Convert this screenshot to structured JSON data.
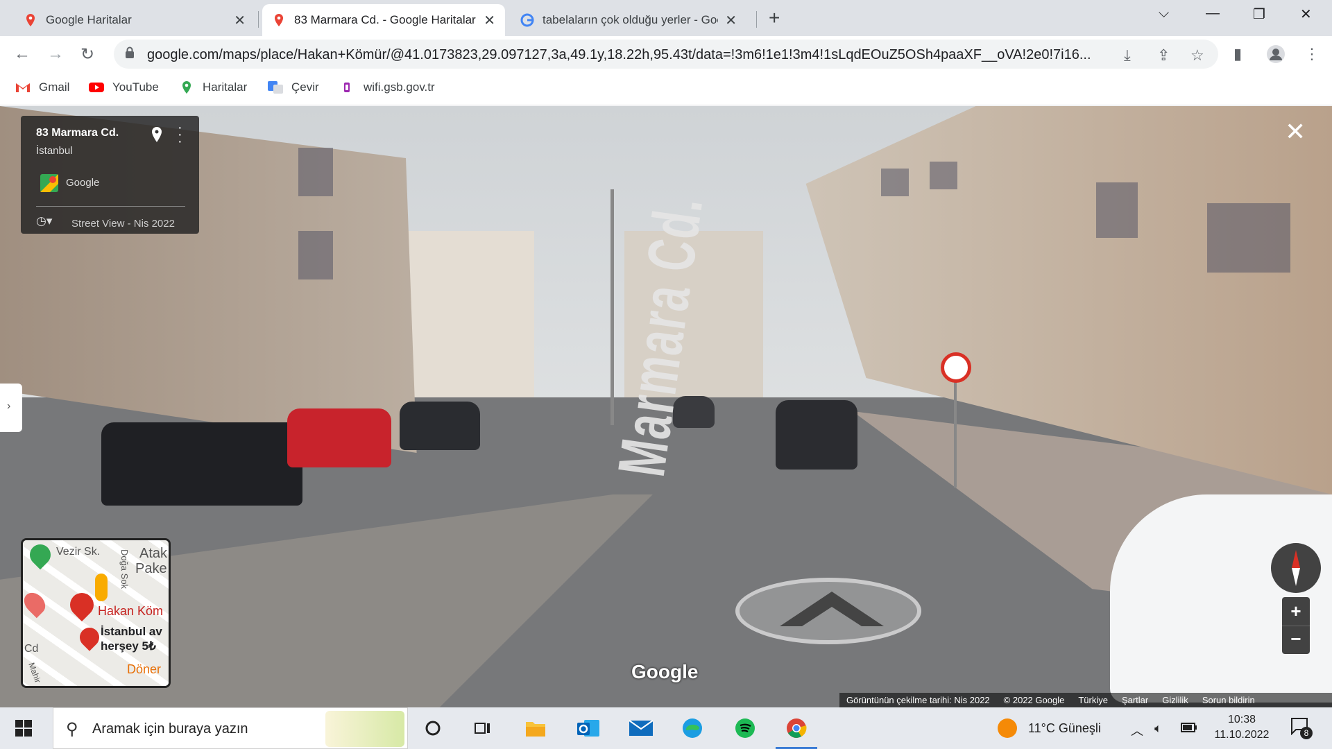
{
  "browser": {
    "tabs": [
      {
        "label": "Google Haritalar"
      },
      {
        "label": "83 Marmara Cd. - Google Haritalar"
      },
      {
        "label": "tabelaların çok olduğu yerler - Google"
      }
    ],
    "url": "google.com/maps/place/Hakan+Kömür/@41.0173823,29.097127,3a,49.1y,18.22h,95.43t/data=!3m6!1e1!3m4!1sLqdEOuZ5OSh4paaXF__oVA!2e0!7i16...",
    "bookmarks": [
      {
        "label": "Gmail",
        "icon": "gmail-icon"
      },
      {
        "label": "YouTube",
        "icon": "youtube-icon"
      },
      {
        "label": "Haritalar",
        "icon": "maps-icon"
      },
      {
        "label": "Çevir",
        "icon": "translate-icon"
      },
      {
        "label": "wifi.gsb.gov.tr",
        "icon": "site-icon"
      }
    ]
  },
  "streetview": {
    "card": {
      "title": "83 Marmara Cd.",
      "subtitle": "İstanbul",
      "provider": "Google",
      "date_label": "Street View - Nis 2022"
    },
    "street_marking": "Marmara Cd.",
    "logo": "Google",
    "footer": [
      "Görüntünün çekilme tarihi: Nis 2022",
      "© 2022 Google",
      "Türkiye",
      "Şartlar",
      "Gizlilik",
      "Sorun bildirin"
    ],
    "zoom_in": "+",
    "zoom_out": "−",
    "minimap": {
      "labels": [
        "Vezir Sk.",
        "Doğa Sok",
        "Atak",
        "Pake",
        "Hakan Köm",
        "İstanbul av",
        "herşey 5₺",
        "Cd",
        "Döner",
        "Mahir"
      ]
    }
  },
  "taskbar": {
    "search_placeholder": "Aramak için buraya yazın",
    "weather": "11°C  Güneşli",
    "time": "10:38",
    "date": "11.10.2022",
    "notification_count": "8"
  }
}
